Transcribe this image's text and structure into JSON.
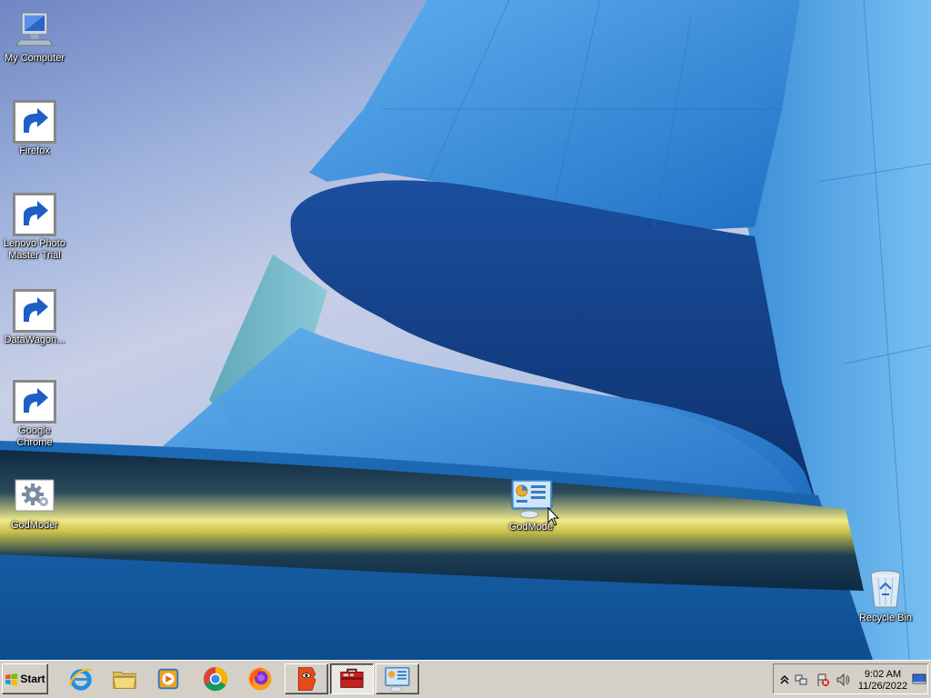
{
  "desktop": {
    "icons": [
      {
        "label": "My Computer"
      },
      {
        "label": "Firefox"
      },
      {
        "label": "Lenovo Photo Master Trial"
      },
      {
        "label": "DataWagon..."
      },
      {
        "label": "Google Chrome"
      },
      {
        "label": "GodModer"
      },
      {
        "label": "GodMode"
      },
      {
        "label": "Recycle Bin"
      }
    ]
  },
  "taskbar": {
    "start_label": "Start",
    "pinned": [
      {
        "icon": "internet-explorer-icon"
      },
      {
        "icon": "windows-explorer-icon"
      },
      {
        "icon": "media-player-icon"
      },
      {
        "icon": "chrome-icon"
      },
      {
        "icon": "firefox-icon"
      }
    ],
    "windows": [
      {
        "icon": "lenovo-photo-master-icon"
      },
      {
        "icon": "toolbox-icon",
        "active": true
      },
      {
        "icon": "godmode-icon"
      }
    ],
    "tray": {
      "time": "9:02 AM",
      "date": "11/26/2022"
    }
  },
  "colors": {
    "taskbar": "#d4d0c8",
    "wallpaper_blue": "#2f7fd0",
    "highlight_yellow": "#e8e070"
  }
}
